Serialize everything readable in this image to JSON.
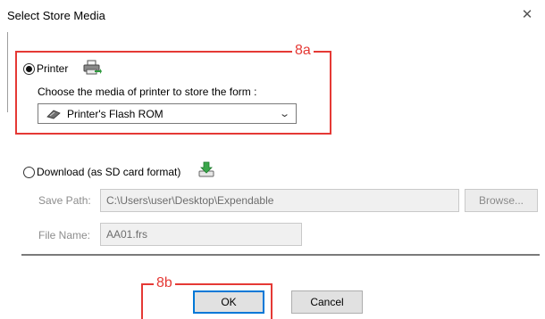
{
  "window": {
    "title": "Select Store Media",
    "close_glyph": "✕"
  },
  "annotations": {
    "a": "8a",
    "b": "8b",
    "color": "#e53935"
  },
  "printer_option": {
    "label": "Printer",
    "selected": true,
    "icon": "printer-icon",
    "prompt": "Choose the media of printer to store the form :",
    "media_select": {
      "value": "Printer's Flash ROM",
      "icon": "flash-rom-icon"
    }
  },
  "download_option": {
    "label": "Download (as SD card format)",
    "selected": false,
    "icon": "download-icon",
    "save_path": {
      "label": "Save Path:",
      "value": "C:\\Users\\user\\Desktop\\Expendable"
    },
    "browse_label": "Browse...",
    "file_name": {
      "label": "File Name:",
      "value": "AA01.frs"
    }
  },
  "buttons": {
    "ok": "OK",
    "cancel": "Cancel"
  }
}
